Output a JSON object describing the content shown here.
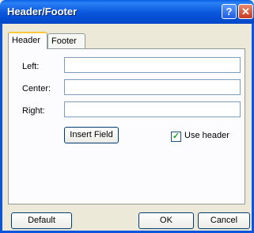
{
  "window": {
    "title": "Header/Footer",
    "help_glyph": "?",
    "close_glyph": "✕"
  },
  "tabs": [
    {
      "label": "Header"
    },
    {
      "label": "Footer"
    }
  ],
  "form": {
    "left_label": "Left:",
    "left_value": "",
    "center_label": "Center:",
    "center_value": "",
    "right_label": "Right:",
    "right_value": ""
  },
  "insert_field_label": "Insert Field",
  "use_header": {
    "label": "Use header",
    "checked": true,
    "check_glyph": "✓"
  },
  "buttons": {
    "default": "Default",
    "ok": "OK",
    "cancel": "Cancel"
  }
}
